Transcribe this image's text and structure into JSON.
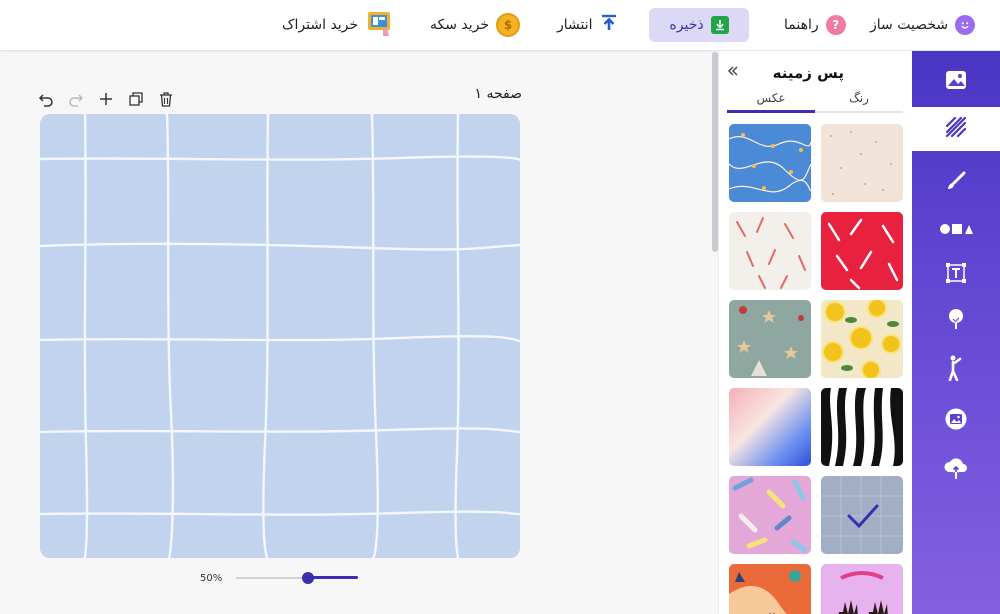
{
  "topbar": {
    "character_maker": "شخصیت ساز",
    "help": "راهنما",
    "save": "ذخیره",
    "publish": "انتشار",
    "buy_coins": "خرید سکه",
    "buy_subscription": "خرید اشتراک"
  },
  "canvas": {
    "page_title": "صفحه ۱",
    "zoom_label": "50%",
    "zoom_level": 0.5
  },
  "panel": {
    "title": "پس زمینه",
    "tabs": [
      {
        "label": "رنگ",
        "active": false
      },
      {
        "label": "عکس",
        "active": true
      }
    ],
    "thumbnails": [
      {
        "name": "confetti-beige"
      },
      {
        "name": "string-lights-blue"
      },
      {
        "name": "candy-cane-red"
      },
      {
        "name": "candy-cane-white"
      },
      {
        "name": "lemons"
      },
      {
        "name": "christmas-stars-green"
      },
      {
        "name": "zebra-stripes"
      },
      {
        "name": "gradient-pastel"
      },
      {
        "name": "grid-selected"
      },
      {
        "name": "crayons-pink"
      },
      {
        "name": "hands-purple"
      },
      {
        "name": "abstract-orange"
      }
    ]
  },
  "sidebar": {
    "items": [
      {
        "icon": "image-icon",
        "active": false
      },
      {
        "icon": "background-pattern-icon",
        "active": true
      },
      {
        "icon": "brush-icon",
        "active": false
      },
      {
        "icon": "shapes-icon",
        "active": false
      },
      {
        "icon": "text-icon",
        "active": false
      },
      {
        "icon": "tree-icon",
        "active": false
      },
      {
        "icon": "character-icon",
        "active": false
      },
      {
        "icon": "photo-frame-icon",
        "active": false
      },
      {
        "icon": "cloud-upload-icon",
        "active": false
      }
    ]
  },
  "colors": {
    "accent": "#3b2fb0",
    "sidebar": "#5a42cf",
    "canvas_bg": "#c2d3ee"
  }
}
